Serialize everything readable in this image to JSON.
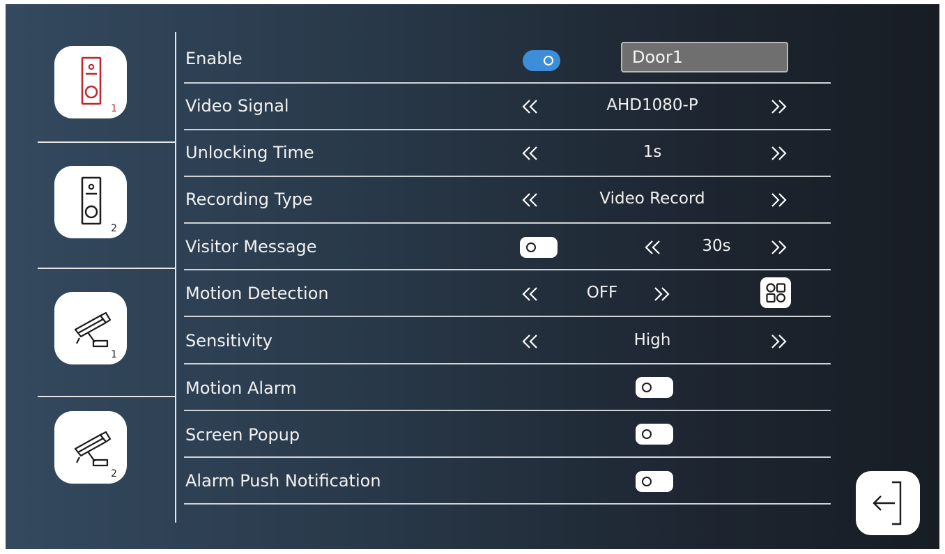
{
  "sidebar": {
    "devices": [
      {
        "kind": "door-station",
        "number": "1",
        "selected": true
      },
      {
        "kind": "door-station",
        "number": "2",
        "selected": false
      },
      {
        "kind": "camera",
        "number": "1",
        "selected": false
      },
      {
        "kind": "camera",
        "number": "2",
        "selected": false
      }
    ]
  },
  "settings": {
    "enable": {
      "label": "Enable",
      "state": "on",
      "name_value": "Door1"
    },
    "video_signal": {
      "label": "Video Signal",
      "value": "AHD1080-P"
    },
    "unlocking_time": {
      "label": "Unlocking Time",
      "value": "1s"
    },
    "recording_type": {
      "label": "Recording Type",
      "value": "Video Record"
    },
    "visitor_message": {
      "label": "Visitor Message",
      "state": "off",
      "value": "30s"
    },
    "motion_detection": {
      "label": "Motion Detection",
      "value": "OFF"
    },
    "sensitivity": {
      "label": "Sensitivity",
      "value": "High"
    },
    "motion_alarm": {
      "label": "Motion Alarm",
      "state": "off"
    },
    "screen_popup": {
      "label": "Screen Popup",
      "state": "off"
    },
    "alarm_push": {
      "label": "Alarm Push Notification",
      "state": "off"
    }
  },
  "colors": {
    "accent_toggle": "#3d8ed8",
    "selected_device": "#c0272d"
  },
  "icons": {
    "prev": "double-chevron-left-icon",
    "next": "double-chevron-right-icon",
    "grid": "grid-icon",
    "exit": "exit-icon"
  }
}
